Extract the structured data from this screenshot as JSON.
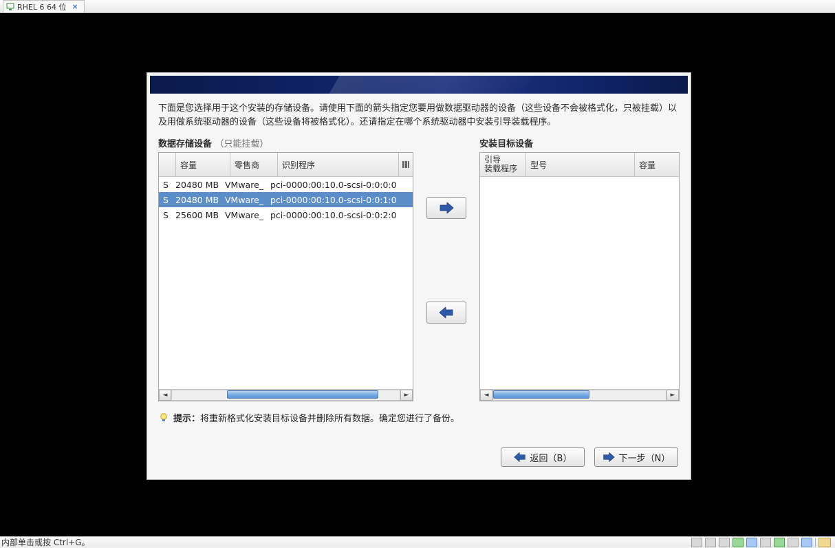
{
  "vm_tab": {
    "label": "RHEL 6 64 位"
  },
  "installer": {
    "description": "下面是您选择用于这个安装的存储设备。请使用下面的箭头指定您要用做数据驱动器的设备（这些设备不会被格式化，只被挂载）以及用做系统驱动器的设备（这些设备将被格式化）。还请指定在哪个系统驱动器中安装引导装载程序。",
    "source_panel": {
      "title": "数据存储设备",
      "subtitle": "（只能挂载）",
      "headers": {
        "c0": "",
        "c1": "容量",
        "c2": "零售商",
        "c3": "识别程序"
      },
      "rows": [
        {
          "c0": "S",
          "c1": "20480 MB",
          "c2": "VMware_",
          "c3": "pci-0000:00:10.0-scsi-0:0:0:0",
          "selected": false
        },
        {
          "c0": "S",
          "c1": "20480 MB",
          "c2": "VMware_",
          "c3": "pci-0000:00:10.0-scsi-0:0:1:0",
          "selected": true
        },
        {
          "c0": "S",
          "c1": "25600 MB",
          "c2": "VMware_",
          "c3": "pci-0000:00:10.0-scsi-0:0:2:0",
          "selected": false
        }
      ]
    },
    "target_panel": {
      "title": "安装目标设备",
      "headers": {
        "c0": "引导\n装载程序",
        "c1": "型号",
        "c2": "容量"
      }
    },
    "tip_label": "提示：",
    "tip_text": "将重新格式化安装目标设备并删除所有数据。确定您进行了备份。",
    "back_label": "返回（B）",
    "next_label": "下一步（N）"
  },
  "status_text": "内部单击或按 Ctrl+G。"
}
